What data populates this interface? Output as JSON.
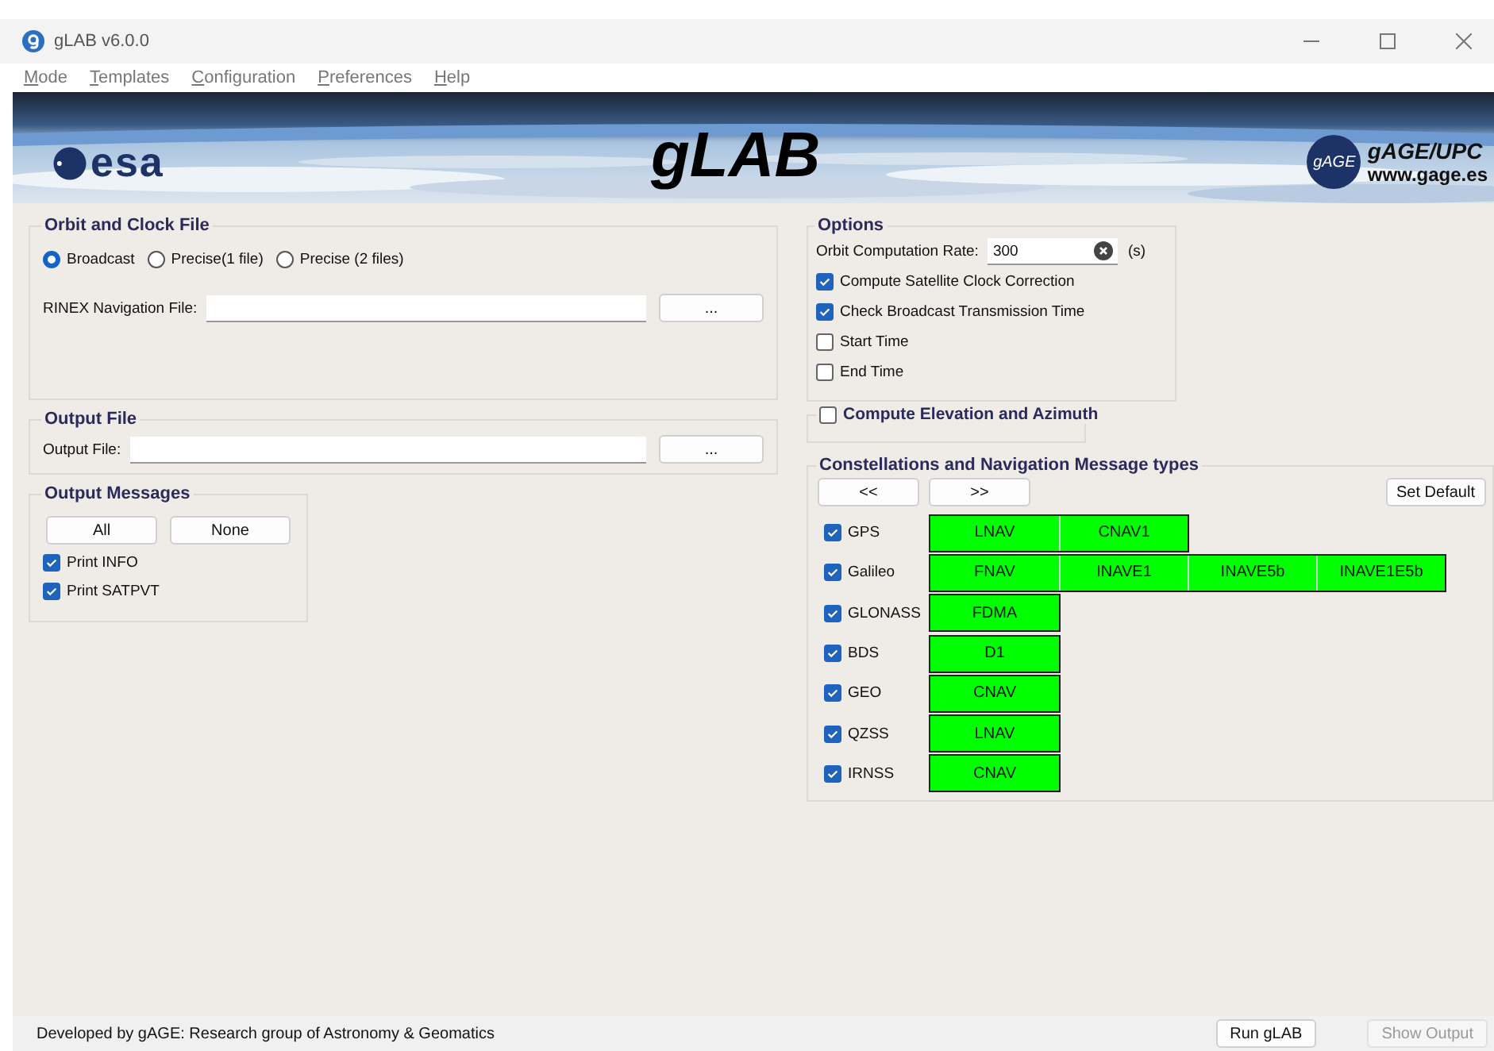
{
  "window": {
    "title": "gLAB v6.0.0"
  },
  "menu": [
    "Mode",
    "Templates",
    "Configuration",
    "Preferences",
    "Help"
  ],
  "banner": {
    "left_logo": "esa",
    "title": "gLAB",
    "badge": "gAGE",
    "right_title": "gAGE/UPC",
    "right_url": "www.gage.es"
  },
  "orbit_clock": {
    "title": "Orbit and Clock File",
    "radios": [
      {
        "label": "Broadcast",
        "selected": true
      },
      {
        "label": "Precise(1 file)",
        "selected": false
      },
      {
        "label": "Precise (2 files)",
        "selected": false
      }
    ],
    "file_label": "RINEX Navigation File:",
    "browse": "..."
  },
  "output_file": {
    "title": "Output File",
    "file_label": "Output File:",
    "browse": "..."
  },
  "output_messages": {
    "title": "Output Messages",
    "buttons": [
      "All",
      "None"
    ],
    "checks": [
      {
        "label": "Print INFO",
        "checked": true
      },
      {
        "label": "Print SATPVT",
        "checked": true
      }
    ]
  },
  "options": {
    "title": "Options",
    "rate_label": "Orbit Computation Rate:",
    "rate_value": "300",
    "rate_unit": "(s)",
    "checks": [
      {
        "label": "Compute Satellite Clock Correction",
        "checked": true
      },
      {
        "label": "Check Broadcast Transmission Time",
        "checked": true
      },
      {
        "label": "Start Time",
        "checked": false
      },
      {
        "label": "End Time",
        "checked": false
      }
    ]
  },
  "elevation": {
    "label": "Compute Elevation and Azimuth",
    "checked": false
  },
  "constellations": {
    "title": "Constellations and Navigation Message types",
    "nav_buttons": [
      "<<",
      ">>"
    ],
    "default_button": "Set Default",
    "rows": [
      {
        "name": "GPS",
        "checked": true,
        "messages": [
          {
            "label": "LNAV",
            "on": true
          },
          {
            "label": "CNAV1",
            "on": true
          }
        ]
      },
      {
        "name": "Galileo",
        "checked": true,
        "messages": [
          {
            "label": "FNAV",
            "on": true
          },
          {
            "label": "INAVE1",
            "on": true
          },
          {
            "label": "INAVE5b",
            "on": true
          },
          {
            "label": "INAVE1E5b",
            "on": true
          }
        ]
      },
      {
        "name": "GLONASS",
        "checked": true,
        "messages": [
          {
            "label": "FDMA",
            "on": true
          }
        ]
      },
      {
        "name": "BDS",
        "checked": true,
        "messages": [
          {
            "label": "D1",
            "on": true
          }
        ]
      },
      {
        "name": "GEO",
        "checked": true,
        "messages": [
          {
            "label": "CNAV",
            "on": true
          }
        ]
      },
      {
        "name": "QZSS",
        "checked": true,
        "messages": [
          {
            "label": "LNAV",
            "on": true
          }
        ]
      },
      {
        "name": "IRNSS",
        "checked": true,
        "messages": [
          {
            "label": "CNAV",
            "on": true
          }
        ]
      }
    ]
  },
  "status_bar": {
    "text": "Developed by gAGE: Research group of Astronomy & Geomatics",
    "buttons": [
      {
        "label": "Run gLAB",
        "disabled": false
      },
      {
        "label": "Show Output",
        "disabled": true
      }
    ]
  }
}
